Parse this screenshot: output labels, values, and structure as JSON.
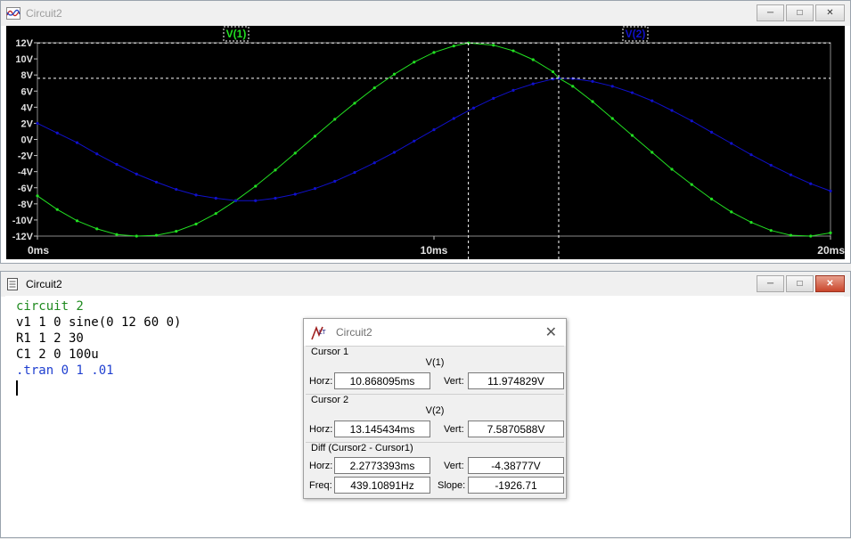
{
  "plot_window": {
    "title": "Circuit2",
    "trace_labels": [
      "V(1)",
      "V(2)"
    ],
    "colors": {
      "v1": "#22e022",
      "v2": "#1010cc",
      "label_bg": "#000000"
    }
  },
  "chart_data": {
    "type": "line",
    "xlim": [
      0,
      20
    ],
    "ylim": [
      -12,
      12
    ],
    "x_ticks": [
      "0ms",
      "10ms",
      "20ms"
    ],
    "y_ticks": [
      "12V",
      "10V",
      "8V",
      "6V",
      "4V",
      "2V",
      "0V",
      "-2V",
      "-4V",
      "-6V",
      "-8V",
      "-10V",
      "-12V"
    ],
    "series": [
      {
        "name": "V(1)",
        "color": "#22e022",
        "x": [
          0,
          0.5,
          1,
          1.5,
          2,
          2.5,
          3,
          3.5,
          4,
          4.5,
          5,
          5.5,
          6,
          6.5,
          7,
          7.5,
          8,
          8.5,
          9,
          9.5,
          10,
          10.5,
          10.87,
          11.5,
          12,
          12.5,
          13,
          13.15,
          13.5,
          14,
          14.5,
          15,
          15.5,
          16,
          16.5,
          17,
          17.5,
          18,
          18.5,
          19,
          19.5,
          20
        ],
        "y": [
          -7.0,
          -8.7,
          -10.1,
          -11.1,
          -11.8,
          -12.0,
          -11.9,
          -11.4,
          -10.5,
          -9.2,
          -7.6,
          -5.8,
          -3.8,
          -1.7,
          0.4,
          2.5,
          4.5,
          6.4,
          8.1,
          9.6,
          10.8,
          11.6,
          11.97,
          11.7,
          11.0,
          9.9,
          8.4,
          7.6,
          6.6,
          4.7,
          2.6,
          0.5,
          -1.6,
          -3.7,
          -5.6,
          -7.4,
          -9.0,
          -10.3,
          -11.3,
          -11.9,
          -12.0,
          -11.6
        ]
      },
      {
        "name": "V(2)",
        "color": "#1010cc",
        "x": [
          0,
          0.5,
          1,
          1.5,
          2,
          2.5,
          3,
          3.5,
          4,
          4.5,
          5,
          5.5,
          6,
          6.5,
          7,
          7.5,
          8,
          8.5,
          9,
          9.5,
          10,
          10.5,
          11,
          11.5,
          12,
          12.5,
          13,
          13.15,
          13.5,
          14,
          14.5,
          15,
          15.5,
          16,
          16.5,
          17,
          17.5,
          18,
          18.5,
          19,
          19.5,
          20
        ],
        "y": [
          2.0,
          0.8,
          -0.4,
          -1.8,
          -3.1,
          -4.3,
          -5.3,
          -6.2,
          -6.9,
          -7.3,
          -7.6,
          -7.6,
          -7.3,
          -6.8,
          -6.1,
          -5.2,
          -4.1,
          -2.9,
          -1.6,
          -0.2,
          1.2,
          2.6,
          3.9,
          5.1,
          6.1,
          6.9,
          7.5,
          7.59,
          7.55,
          7.2,
          6.6,
          5.8,
          4.8,
          3.6,
          2.3,
          0.9,
          -0.5,
          -1.9,
          -3.2,
          -4.4,
          -5.5,
          -6.4
        ]
      }
    ],
    "cursors": [
      {
        "x": 10.868095,
        "y": 11.974829
      },
      {
        "x": 13.145434,
        "y": 7.5870588
      }
    ]
  },
  "netlist_window": {
    "title": "Circuit2",
    "lines": [
      {
        "text": "circuit 2",
        "color": "green"
      },
      {
        "text": "v1 1 0 sine(0 12 60 0)",
        "color": "black"
      },
      {
        "text": "R1 1 2 30",
        "color": "black"
      },
      {
        "text": "C1 2 0 100u",
        "color": "black"
      },
      {
        "text": ".tran 0 1 .01",
        "color": "blue"
      }
    ]
  },
  "cursor_dialog": {
    "title": "Circuit2",
    "cursor1": {
      "label": "Cursor 1",
      "trace": "V(1)",
      "horz_label": "Horz:",
      "horz": "10.868095ms",
      "vert_label": "Vert:",
      "vert": "11.974829V"
    },
    "cursor2": {
      "label": "Cursor 2",
      "trace": "V(2)",
      "horz_label": "Horz:",
      "horz": "13.145434ms",
      "vert_label": "Vert:",
      "vert": "7.5870588V"
    },
    "diff": {
      "label": "Diff (Cursor2 - Cursor1)",
      "horz_label": "Horz:",
      "horz": "2.2773393ms",
      "vert_label": "Vert:",
      "vert": "-4.38777V",
      "freq_label": "Freq:",
      "freq": "439.10891Hz",
      "slope_label": "Slope:",
      "slope": "-1926.71"
    }
  }
}
